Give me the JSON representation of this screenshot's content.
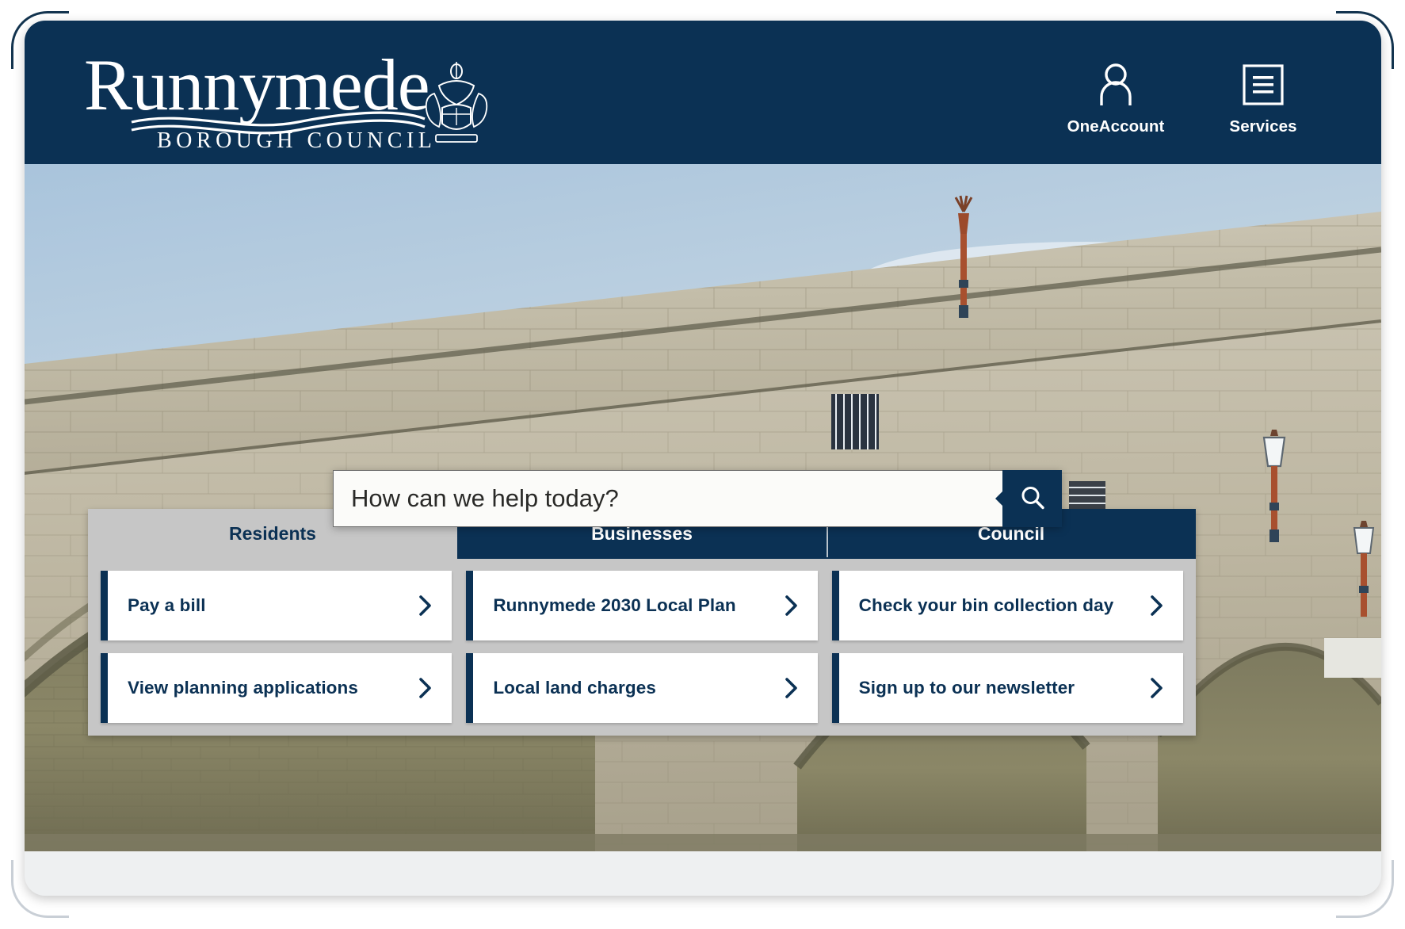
{
  "header": {
    "logo": {
      "name": "Runnymede",
      "subtitle": "BOROUGH COUNCIL",
      "crest_icon": "coat-of-arms-icon"
    },
    "nav": [
      {
        "label": "OneAccount",
        "icon": "user-icon"
      },
      {
        "label": "Services",
        "icon": "hamburger-menu-icon"
      }
    ],
    "background_color": "#0b3154"
  },
  "hero": {
    "image_description": "Stone arch bridge over a river with ornate lampposts and cloudy sky",
    "search": {
      "placeholder": "How can we help today?",
      "value": "",
      "button_icon": "search-icon",
      "button_label": "Search"
    }
  },
  "panel": {
    "tabs": [
      {
        "label": "Residents",
        "active": true
      },
      {
        "label": "Businesses",
        "active": false
      },
      {
        "label": "Council",
        "active": false
      }
    ],
    "columns": [
      {
        "cards": [
          {
            "label": "Pay a bill",
            "icon": "chevron-right-icon"
          },
          {
            "label": "View planning applications",
            "icon": "chevron-right-icon"
          }
        ]
      },
      {
        "cards": [
          {
            "label": "Runnymede 2030 Local Plan",
            "icon": "chevron-right-icon"
          },
          {
            "label": "Local land charges",
            "icon": "chevron-right-icon"
          }
        ]
      },
      {
        "cards": [
          {
            "label": "Check your bin collection day",
            "icon": "chevron-right-icon"
          },
          {
            "label": "Sign up to our newsletter",
            "icon": "chevron-right-icon"
          }
        ]
      }
    ]
  },
  "colors": {
    "brand_navy": "#0b3154",
    "panel_grey": "#c6c6c6",
    "card_white": "#ffffff",
    "page_grey": "#eef0f1"
  }
}
